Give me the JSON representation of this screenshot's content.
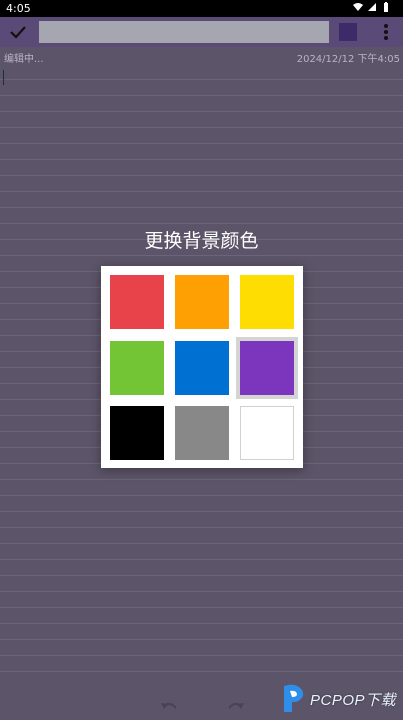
{
  "status_bar": {
    "time": "4:05",
    "icons": [
      "wifi-icon",
      "signal-icon",
      "battery-icon"
    ]
  },
  "toolbar": {
    "confirm_icon": "check-icon",
    "title_value": "",
    "current_color": "#3d2a68",
    "menu_icon": "more-vert-icon"
  },
  "editor": {
    "status": "编辑中...",
    "timestamp": "2024/12/12 下午4:05",
    "content": ""
  },
  "dialog": {
    "title": "更换背景颜色",
    "colors": [
      {
        "name": "red",
        "hex": "#e8434b",
        "selected": false
      },
      {
        "name": "orange",
        "hex": "#fea003",
        "selected": false
      },
      {
        "name": "yellow",
        "hex": "#fedd02",
        "selected": false
      },
      {
        "name": "green",
        "hex": "#73c535",
        "selected": false
      },
      {
        "name": "blue",
        "hex": "#0170d3",
        "selected": false
      },
      {
        "name": "purple",
        "hex": "#7c35bd",
        "selected": true
      },
      {
        "name": "black",
        "hex": "#000000",
        "selected": false
      },
      {
        "name": "gray",
        "hex": "#888888",
        "selected": false
      },
      {
        "name": "white",
        "hex": "#ffffff",
        "selected": false
      }
    ]
  },
  "bottom_bar": {
    "undo_icon": "undo-icon",
    "redo_icon": "redo-icon"
  },
  "watermark": {
    "text": "PCPOP下载"
  },
  "theme": {
    "toolbar_bg": "#5a4a78",
    "note_bg": "#5c5468",
    "line_color": "#6c6479"
  }
}
